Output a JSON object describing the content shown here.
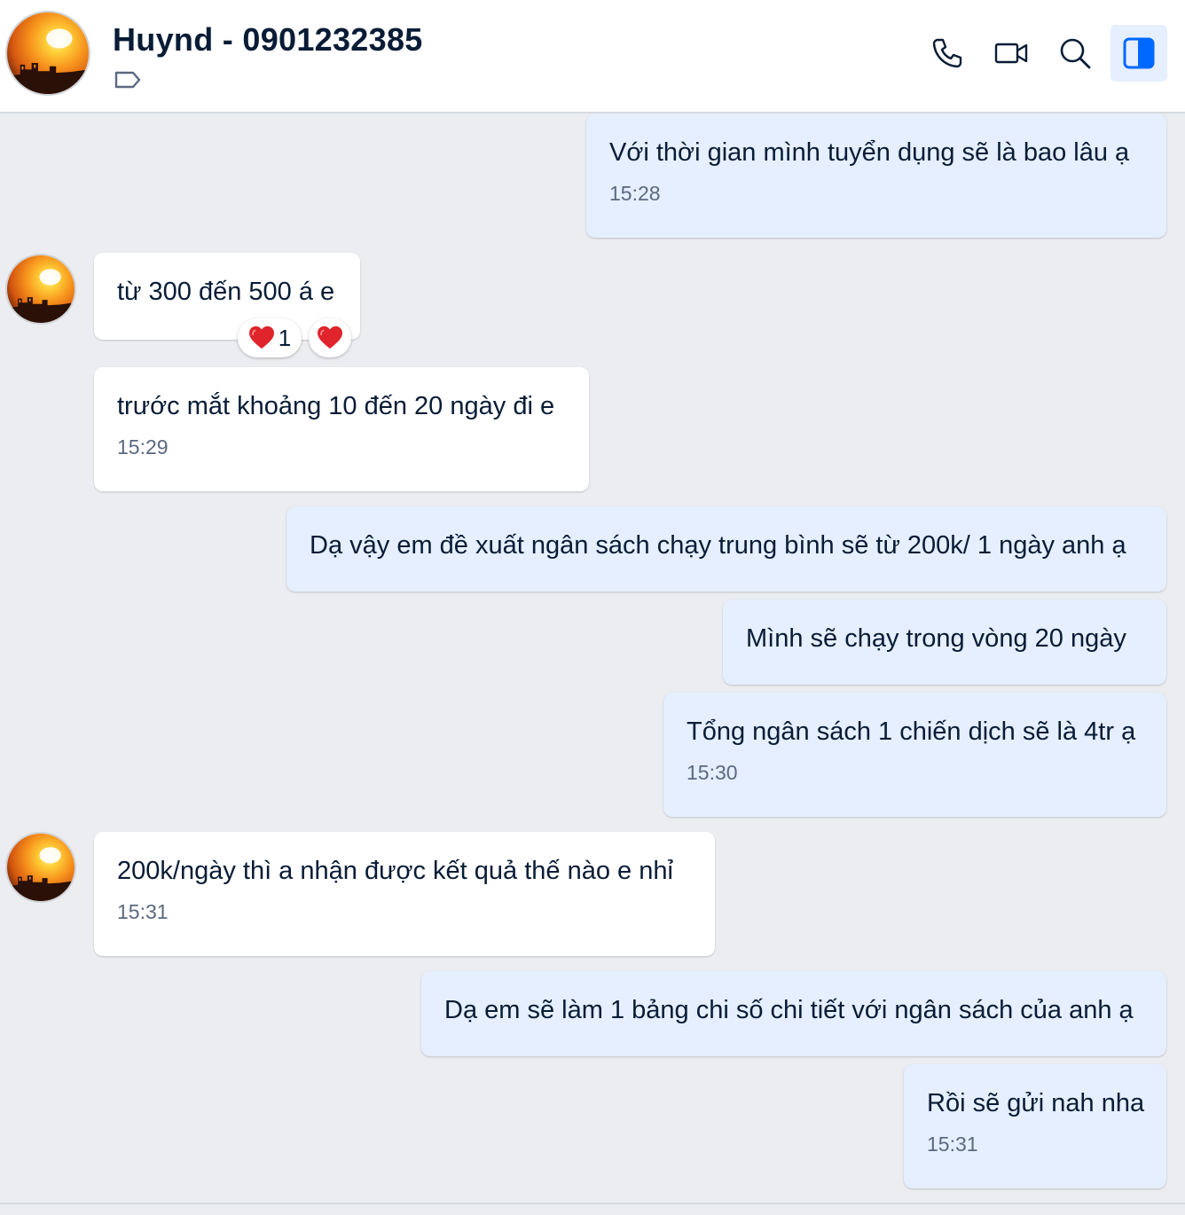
{
  "header": {
    "contact_name": "Huynd - 0901232385"
  },
  "icons": {
    "tag": "tag-icon",
    "call": "phone-icon",
    "video": "video-call-icon",
    "search": "search-icon",
    "panel": "sidebar-panel-icon"
  },
  "colors": {
    "outgoing_bubble": "#e5efff",
    "incoming_bubble": "#ffffff",
    "background": "#ebedf0",
    "accent": "#0068ff",
    "reaction_heart": "#e0242c"
  },
  "messages": [
    {
      "direction": "out",
      "text": "Với thời gian mình tuyển dụng sẽ là bao lâu ạ",
      "time": "15:28"
    },
    {
      "direction": "in",
      "text": "từ 300 đến 500 á e",
      "time": "",
      "reaction_count": "1"
    },
    {
      "direction": "in",
      "text": "trước mắt khoảng 10 đến 20 ngày đi e",
      "time": "15:29"
    },
    {
      "direction": "out",
      "text": "Dạ vậy em đề xuất ngân sách chạy trung bình sẽ từ 200k/ 1 ngày anh ạ",
      "time": ""
    },
    {
      "direction": "out",
      "text": "Mình sẽ chạy trong vòng 20 ngày",
      "time": ""
    },
    {
      "direction": "out",
      "text": "Tổng ngân sách 1 chiến dịch sẽ là 4tr ạ",
      "time": "15:30"
    },
    {
      "direction": "in",
      "text": "200k/ngày thì a nhận được kết quả thế nào e nhỉ",
      "time": "15:31"
    },
    {
      "direction": "out",
      "text": "Dạ em sẽ làm 1 bảng chi số chi tiết với ngân sách của anh ạ",
      "time": ""
    },
    {
      "direction": "out",
      "text": "Rồi sẽ gửi nah nha",
      "time": "15:31"
    }
  ]
}
